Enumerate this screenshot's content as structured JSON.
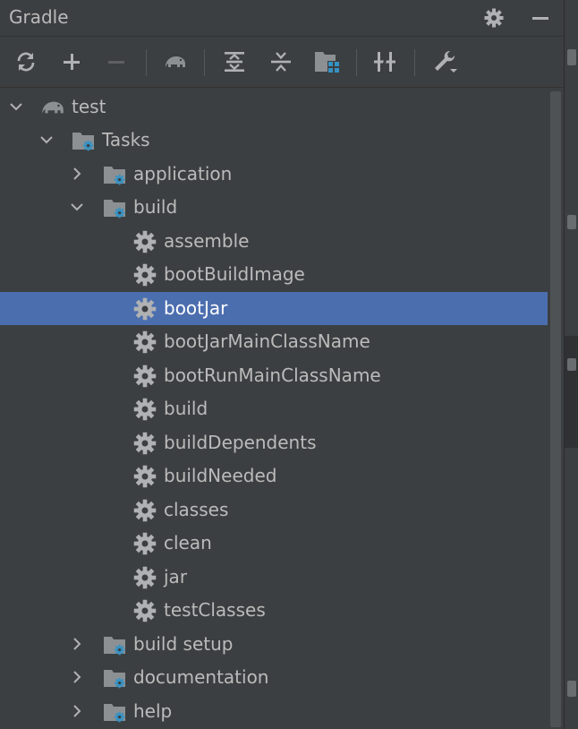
{
  "panel": {
    "title": "Gradle"
  },
  "toolbar": {
    "buttons": [
      {
        "name": "reload-icon"
      },
      {
        "name": "plus-icon"
      },
      {
        "name": "minus-icon"
      },
      {
        "name": "elephant-icon"
      },
      {
        "name": "expand-all-icon"
      },
      {
        "name": "collapse-all-icon"
      },
      {
        "name": "group-modules-icon"
      },
      {
        "name": "toggle-offline-icon"
      },
      {
        "name": "wrench-icon"
      }
    ]
  },
  "tree": {
    "root": "test",
    "tasks": "Tasks",
    "application": "application",
    "build_group": "build",
    "build_tasks": [
      "assemble",
      "bootBuildImage",
      "bootJar",
      "bootJarMainClassName",
      "bootRunMainClassName",
      "build",
      "buildDependents",
      "buildNeeded",
      "classes",
      "clean",
      "jar",
      "testClasses"
    ],
    "other_groups": [
      "build setup",
      "documentation",
      "help"
    ],
    "selected": "bootJar"
  },
  "colors": {
    "background": "#3c3f41",
    "selection": "#4b6eaf",
    "text": "#bbbbbb",
    "icon": "#afb1b3",
    "accent_blue": "#3592c4"
  }
}
